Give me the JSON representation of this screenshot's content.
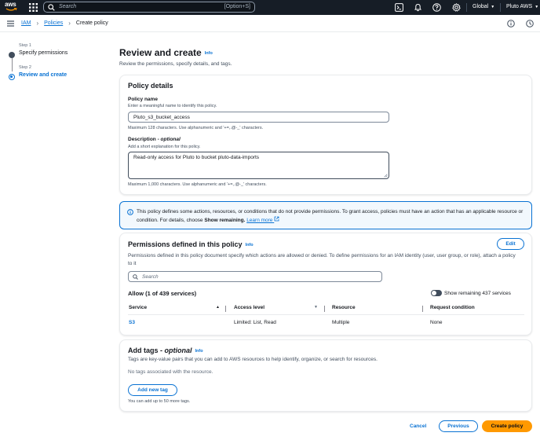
{
  "topbar": {
    "logo_text": "aws",
    "search_placeholder": "Search",
    "search_shortcut": "[Option+S]",
    "region": "Global",
    "account": "Pluto AWS",
    "icons": [
      "cloudshell-icon",
      "bell-icon",
      "help-icon",
      "gear-icon"
    ]
  },
  "breadcrumb": {
    "items": [
      "IAM",
      "Policies",
      "Create policy"
    ]
  },
  "wizard": {
    "steps": [
      {
        "number": "Step 1",
        "label": "Specify permissions",
        "state": "completed"
      },
      {
        "number": "Step 2",
        "label": "Review and create",
        "state": "active"
      }
    ]
  },
  "page": {
    "title": "Review and create",
    "info": "Info",
    "subtitle": "Review the permissions, specify details, and tags."
  },
  "policy_details": {
    "heading": "Policy details",
    "name_label": "Policy name",
    "name_desc": "Enter a meaningful name to identify this policy.",
    "name_value": "Pluto_s3_bucket_access",
    "name_constraint": "Maximum 128 characters. Use alphanumeric and '+=,.@-_' characters.",
    "desc_label": "Description",
    "desc_optional": "optional",
    "desc_desc": "Add a short explanation for this policy.",
    "desc_value": "Read-only access for Pluto to bucket pluto-data-imports",
    "desc_constraint": "Maximum 1,000 characters. Use alphanumeric and '+=,.@-_' characters."
  },
  "alert": {
    "text": "This policy defines some actions, resources, or conditions that do not provide permissions. To grant access, policies must have an action that has an applicable resource or condition. For details, choose ",
    "bold": "Show remaining.",
    "link": "Learn more",
    "accent": "#0972d3"
  },
  "permissions": {
    "heading": "Permissions defined in this policy",
    "info": "Info",
    "edit_label": "Edit",
    "desc": "Permissions defined in this policy document specify which actions are allowed or denied. To define permissions for an IAM identity (user, user group, or role), attach a policy to it",
    "search_placeholder": "Search",
    "allow_title": "Allow (1 of 439 services)",
    "toggle_label": "Show remaining 437 services",
    "columns": [
      "Service",
      "Access level",
      "Resource",
      "Request condition"
    ],
    "rows": [
      {
        "service": "S3",
        "access_level": "Limited: List, Read",
        "resource": "Multiple",
        "condition": "None"
      }
    ]
  },
  "tags": {
    "heading": "Add tags",
    "optional": "optional",
    "info": "Info",
    "desc": "Tags are key-value pairs that you can add to AWS resources to help identify, organize, or search for resources.",
    "empty": "No tags associated with the resource.",
    "add_label": "Add new tag",
    "limit": "You can add up to 50 more tags."
  },
  "footer": {
    "cancel": "Cancel",
    "previous": "Previous",
    "create": "Create policy",
    "primary_color": "#ff9900"
  }
}
